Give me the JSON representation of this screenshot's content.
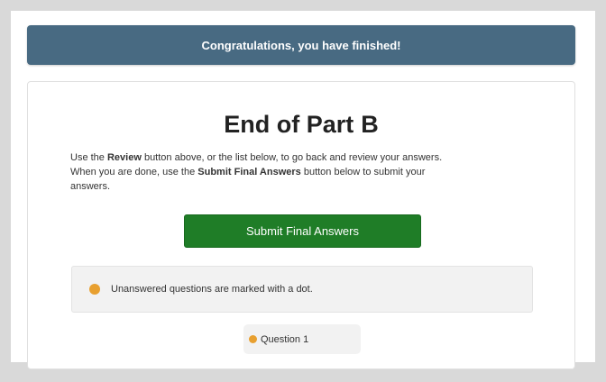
{
  "banner": {
    "text": "Congratulations, you have finished!"
  },
  "panel": {
    "title": "End of Part",
    "part_letter": "B",
    "instructions": {
      "line1_pre": "Use the ",
      "line1_bold": "Review",
      "line1_post": " button above, or the list below, to go back and review your answers.",
      "line2_pre": "When you are done, use the ",
      "line2_bold": "Submit Final Answers",
      "line2_post": " button below to submit your",
      "line3": "answers."
    },
    "submit_label": "Submit Final Answers",
    "legend_text": "Unanswered questions are marked with a dot.",
    "questions": [
      {
        "label": "Question 1",
        "unanswered": true
      }
    ]
  },
  "colors": {
    "banner_bg": "#486a82",
    "submit_bg": "#1f7d27",
    "unanswered_dot": "#e8a030",
    "frame": "#d9d9d9"
  }
}
